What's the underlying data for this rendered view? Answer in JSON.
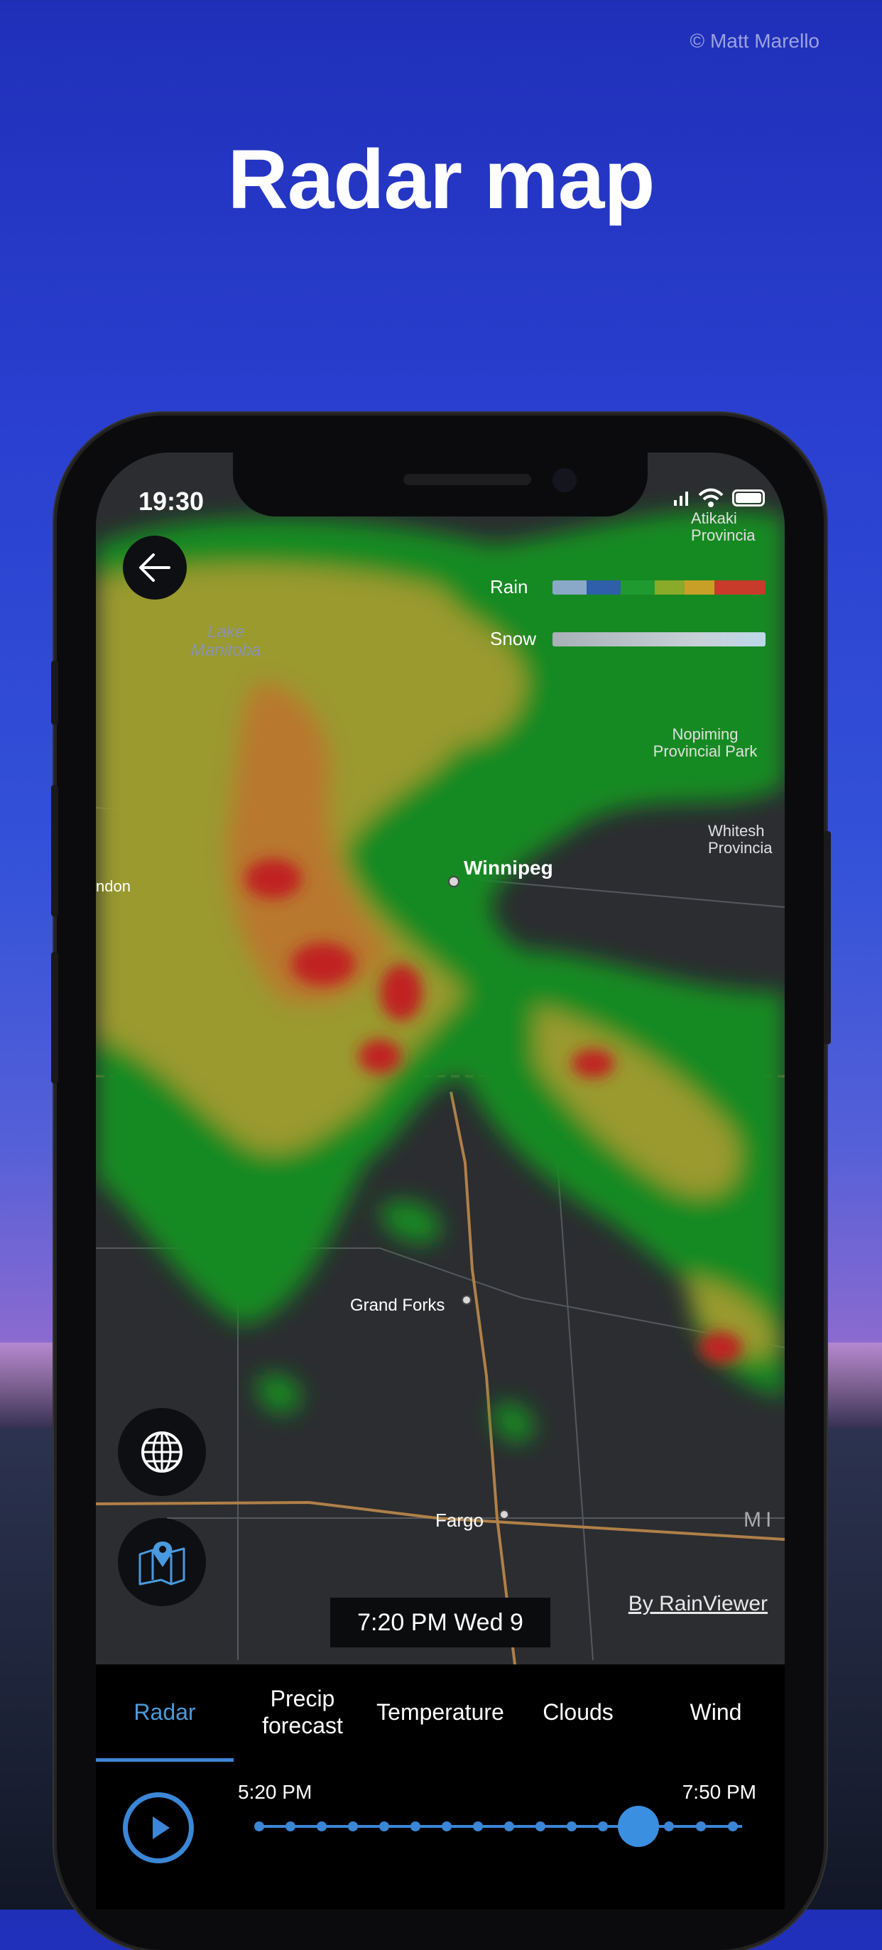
{
  "credit": "© Matt Marello",
  "headline": "Radar map",
  "status": {
    "time": "19:30"
  },
  "legend": {
    "rain_label": "Rain",
    "snow_label": "Snow"
  },
  "map_labels": {
    "lake": "Lake\nManitoba",
    "atikaki": "Atikaki\nProvincia",
    "nopiming": "Nopiming\nProvincial Park",
    "whiteshell": "Whitesh\nProvincia",
    "brandon": "ndon",
    "winnipeg": "Winnipeg",
    "grand_forks": "Grand Forks",
    "fargo": "Fargo",
    "mi": "MI"
  },
  "timestamp": "7:20 PM Wed 9",
  "attribution": "By RainViewer",
  "tabs": [
    {
      "label": "Radar",
      "active": true
    },
    {
      "label": "Precip\nforecast",
      "active": false
    },
    {
      "label": "Temperature",
      "active": false
    },
    {
      "label": "Clouds",
      "active": false
    },
    {
      "label": "Wind",
      "active": false
    }
  ],
  "timeline": {
    "start": "5:20 PM",
    "end": "7:50 PM",
    "progress": 0.81
  },
  "colors": {
    "accent": "#3b86d6",
    "background": "#000000"
  }
}
